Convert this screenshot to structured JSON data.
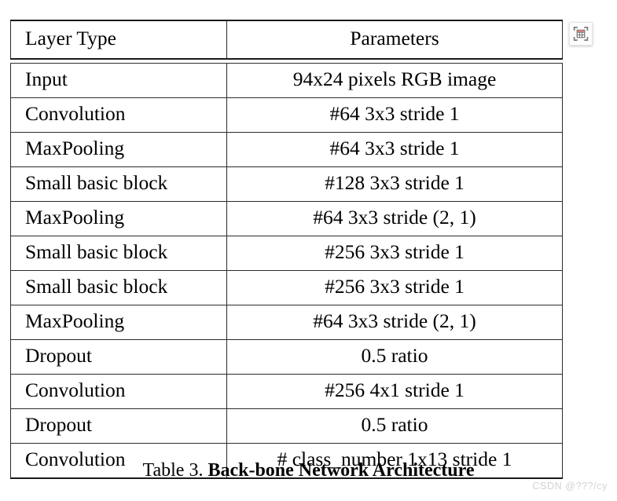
{
  "page": {
    "background_color": "#ffffff",
    "text_color": "#000000"
  },
  "table": {
    "border_color": "#2b2b2b",
    "rule_color": "#1a1a1a",
    "columns": [
      "Layer Type",
      "Parameters"
    ],
    "rows": [
      {
        "layer": "Input",
        "params": "94x24 pixels RGB image"
      },
      {
        "layer": "Convolution",
        "params": "#64 3x3 stride 1"
      },
      {
        "layer": "MaxPooling",
        "params": "#64 3x3 stride 1"
      },
      {
        "layer": "Small basic block",
        "params": "#128 3x3 stride 1"
      },
      {
        "layer": "MaxPooling",
        "params": "#64 3x3 stride (2, 1)"
      },
      {
        "layer": "Small basic block",
        "params": "#256 3x3 stride 1"
      },
      {
        "layer": "Small basic block",
        "params": "#256 3x3 stride 1"
      },
      {
        "layer": "MaxPooling",
        "params": "#64 3x3 stride (2, 1)"
      },
      {
        "layer": "Dropout",
        "params": "0.5 ratio"
      },
      {
        "layer": "Convolution",
        "params": "#256 4x1 stride 1"
      },
      {
        "layer": "Dropout",
        "params": "0.5 ratio"
      },
      {
        "layer": "Convolution",
        "params": "# class_number 1x13 stride 1"
      }
    ]
  },
  "caption": {
    "label": "Table 3.",
    "title": "Back-bone Network Architecture"
  },
  "capture_button": {
    "icon": "table-capture-icon",
    "frame_color": "#7d7d7d",
    "grid_color": "#6e6e6e",
    "accent_color": "#e8837c",
    "background_color": "#fdfdfd"
  },
  "watermark": {
    "text": "CSDN @???/cy",
    "color": "#d2d2d2"
  }
}
